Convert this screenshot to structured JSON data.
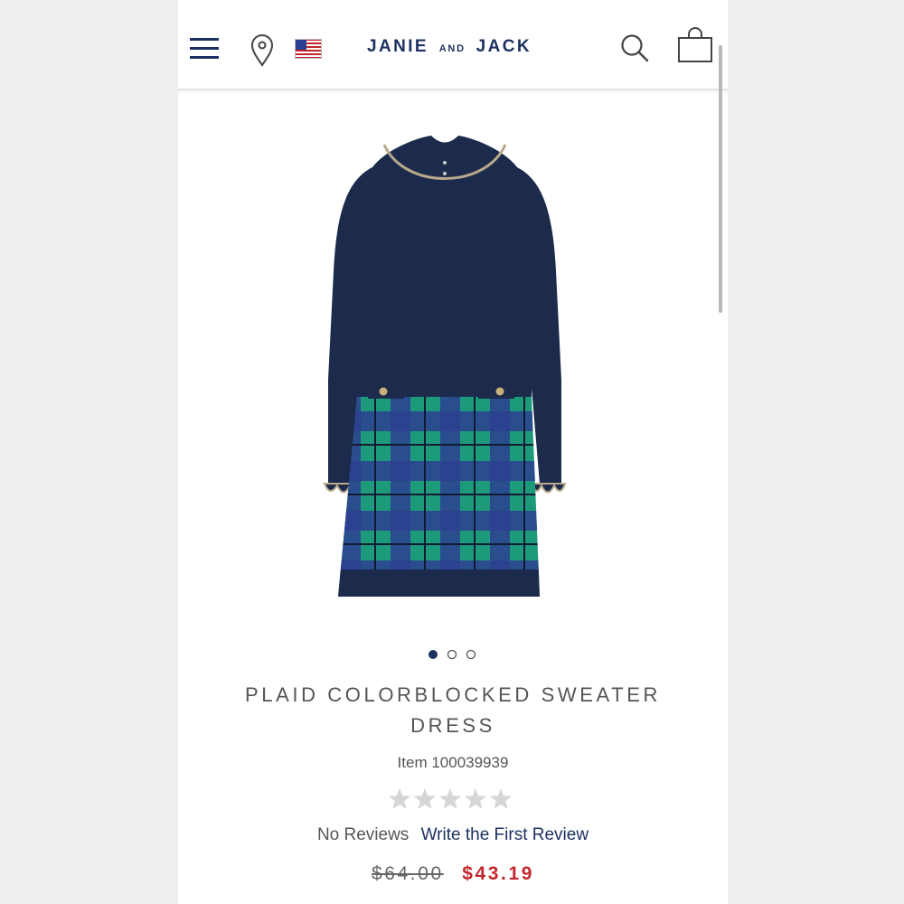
{
  "header": {
    "logo_main_left": "JANIE",
    "logo_small": "AND",
    "logo_main_right": "JACK",
    "icons": [
      "menu-icon",
      "location-pin-icon",
      "us-flag-icon",
      "search-icon",
      "shopping-bag-icon"
    ]
  },
  "product": {
    "image_alt": "plaid-colorblocked-sweater-dress-image",
    "carousel": {
      "count": 3,
      "active": 1
    },
    "title_line1": "PLAID COLORBLOCKED SWEATER",
    "title_line2": "DRESS",
    "item_number": "Item 100039939",
    "rating": {
      "stars": 0,
      "max": 5
    },
    "reviews_text": "No Reviews",
    "write_review": "Write the First Review",
    "original_price": "$64.00",
    "sale_price": "$43.19"
  },
  "colors": {
    "brand_navy": "#1d3160",
    "sale_red": "#c1272d",
    "dress_navy": "#1c2b4c",
    "plaid_green": "#1c9a7a",
    "plaid_blue": "#2d3f91"
  }
}
